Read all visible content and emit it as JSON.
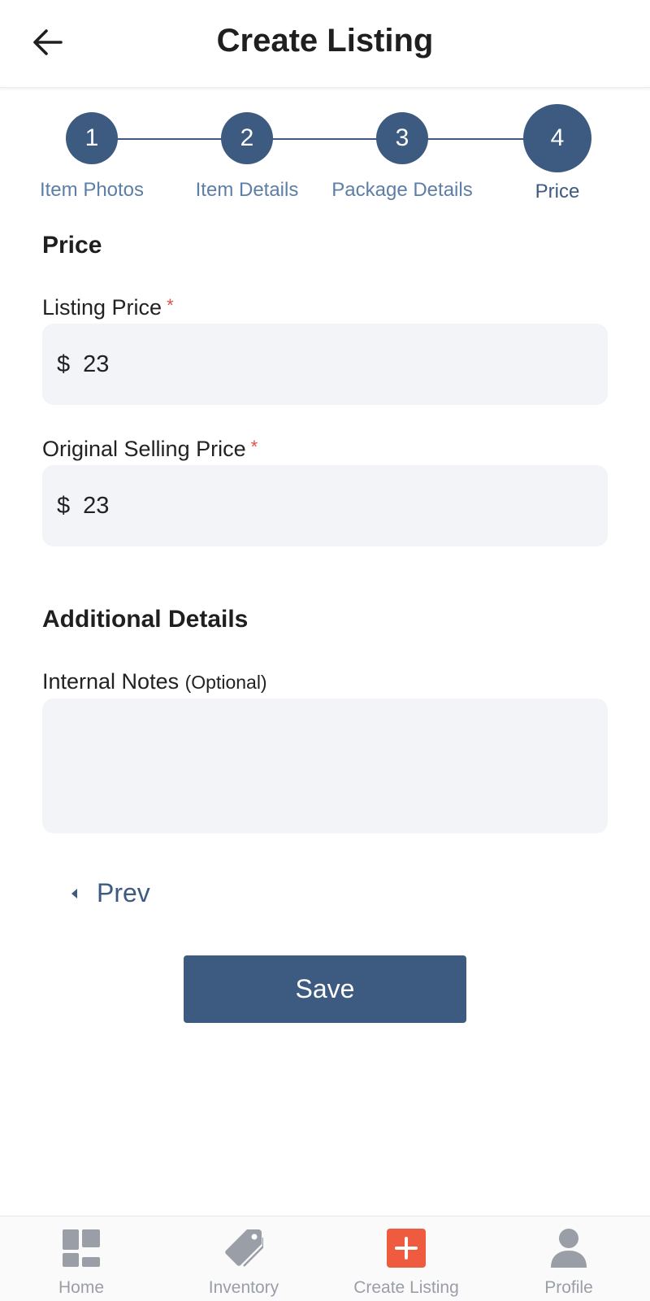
{
  "header": {
    "title": "Create Listing",
    "back_icon": "arrow-left-icon"
  },
  "stepper": {
    "steps": [
      {
        "number": "1",
        "label": "Item Photos",
        "active": false
      },
      {
        "number": "2",
        "label": "Item Details",
        "active": false
      },
      {
        "number": "3",
        "label": "Package Details",
        "active": false
      },
      {
        "number": "4",
        "label": "Price",
        "active": true
      }
    ]
  },
  "price_section": {
    "title": "Price",
    "listing_price": {
      "label": "Listing Price",
      "required_mark": "*",
      "currency": "$",
      "value": "23"
    },
    "original_price": {
      "label": "Original Selling Price",
      "required_mark": "*",
      "currency": "$",
      "value": "23"
    }
  },
  "additional_section": {
    "title": "Additional Details",
    "notes": {
      "label": "Internal Notes",
      "optional": "(Optional)",
      "value": ""
    }
  },
  "actions": {
    "prev_label": "Prev",
    "save_label": "Save"
  },
  "bottom_nav": {
    "items": [
      {
        "label": "Home",
        "icon": "dashboard-icon"
      },
      {
        "label": "Inventory",
        "icon": "tag-icon"
      },
      {
        "label": "Create Listing",
        "icon": "plus-icon"
      },
      {
        "label": "Profile",
        "icon": "user-icon"
      }
    ]
  },
  "colors": {
    "primary": "#3d5a80",
    "accent": "#ef5b3f",
    "required": "#e0504a",
    "input_bg": "#f3f4f8",
    "nav_inactive": "#9a9ea6"
  }
}
